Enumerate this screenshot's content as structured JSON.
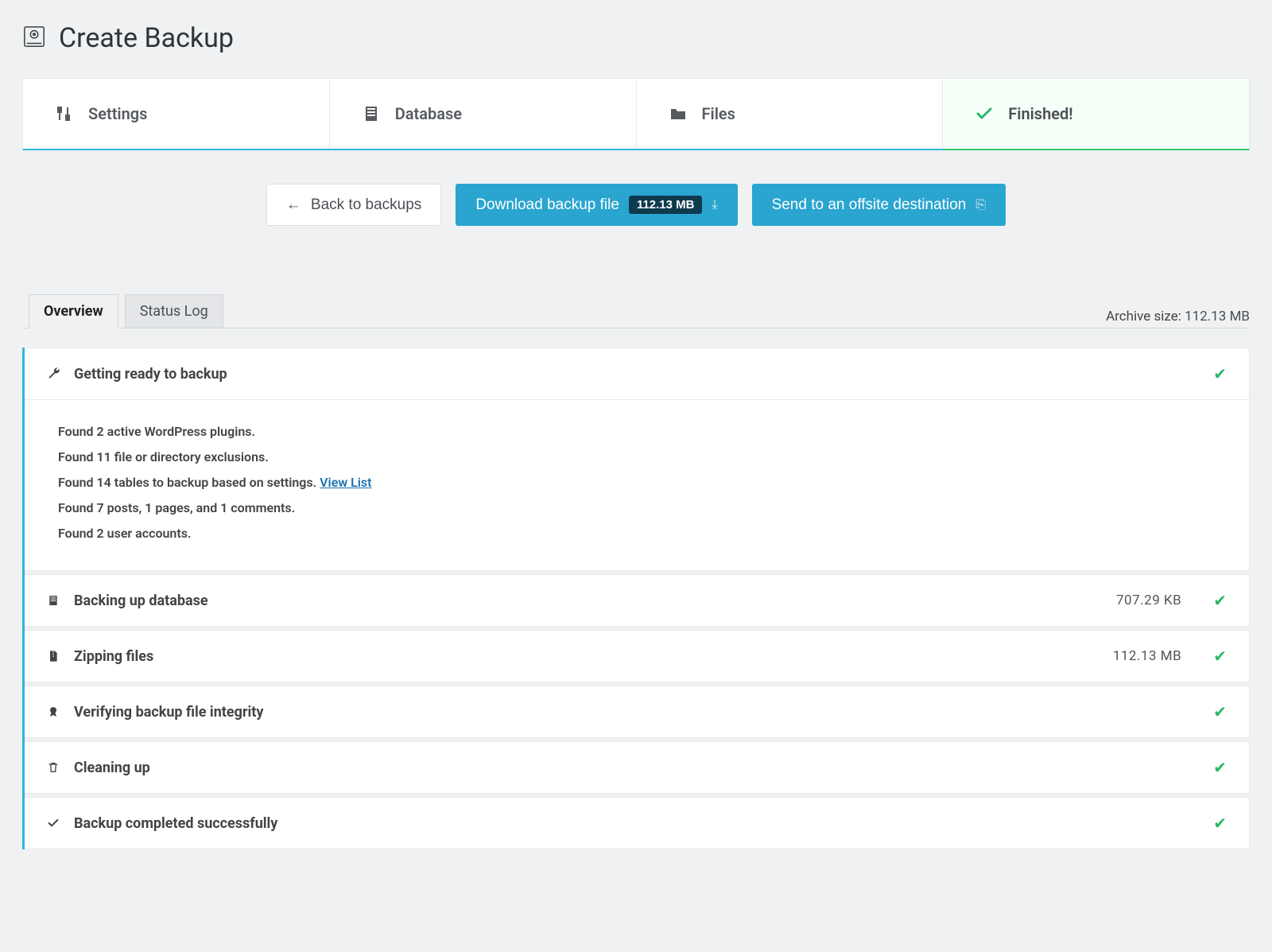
{
  "page": {
    "title": "Create Backup"
  },
  "steps": [
    {
      "label": "Settings"
    },
    {
      "label": "Database"
    },
    {
      "label": "Files"
    },
    {
      "label": "Finished!"
    }
  ],
  "actions": {
    "back_label": "Back to backups",
    "download_label": "Download backup file",
    "download_size": "112.13 MB",
    "offsite_label": "Send to an offsite destination"
  },
  "subtabs": {
    "overview": "Overview",
    "status_log": "Status Log"
  },
  "archive": {
    "label": "Archive size:",
    "value": "112.13 MB"
  },
  "status": {
    "getting_ready": {
      "title": "Getting ready to backup",
      "details": {
        "line1": "Found 2 active WordPress plugins.",
        "line2": "Found 11 file or directory exclusions.",
        "line3_prefix": "Found 14 tables to backup based on settings. ",
        "line3_link": "View List",
        "line4": "Found 7 posts, 1 pages, and 1 comments.",
        "line5": "Found 2 user accounts."
      }
    },
    "backing_up_db": {
      "title": "Backing up database",
      "value": "707.29 KB"
    },
    "zipping": {
      "title": "Zipping files",
      "value": "112.13 MB"
    },
    "verifying": {
      "title": "Verifying backup file integrity"
    },
    "cleaning": {
      "title": "Cleaning up"
    },
    "completed": {
      "title": "Backup completed successfully"
    }
  }
}
